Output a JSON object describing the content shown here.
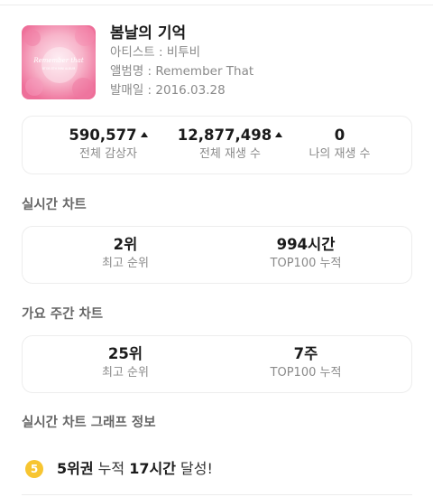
{
  "album": {
    "title": "봄날의 기억",
    "artist_line": "아티스트 : 비투비",
    "album_line": "앨범명 : Remember That",
    "release_line": "발매일 : 2016.03.28",
    "cover_text": "Remember that",
    "cover_subtext": "BTOB 8TH MINI ALBUM",
    "cover_color": "#f29bb8"
  },
  "stats": {
    "total_listeners": {
      "value": "590,577",
      "label": "전체 감상자",
      "trend": "up"
    },
    "total_plays": {
      "value": "12,877,498",
      "label": "전체 재생 수",
      "trend": "up"
    },
    "my_plays": {
      "value": "0",
      "label": "나의 재생 수"
    }
  },
  "realtime_chart": {
    "title": "실시간 차트",
    "peak": {
      "value": "2위",
      "label": "최고 순위"
    },
    "top100": {
      "value": "994시간",
      "label": "TOP100 누적"
    }
  },
  "weekly_chart": {
    "title": "가요 주간 차트",
    "peak": {
      "value": "25위",
      "label": "최고 순위"
    },
    "top100": {
      "value": "7주",
      "label": "TOP100 누적"
    }
  },
  "graph_section": {
    "title": "실시간 차트 그래프 정보",
    "achievement": {
      "badge": "5",
      "rank": "5위권",
      "mid": "누적",
      "duration": "17시간",
      "suffix": "달성!"
    }
  },
  "colors": {
    "badge": "#f7c531",
    "muted": "#8a8a8a",
    "border": "#ededed"
  }
}
